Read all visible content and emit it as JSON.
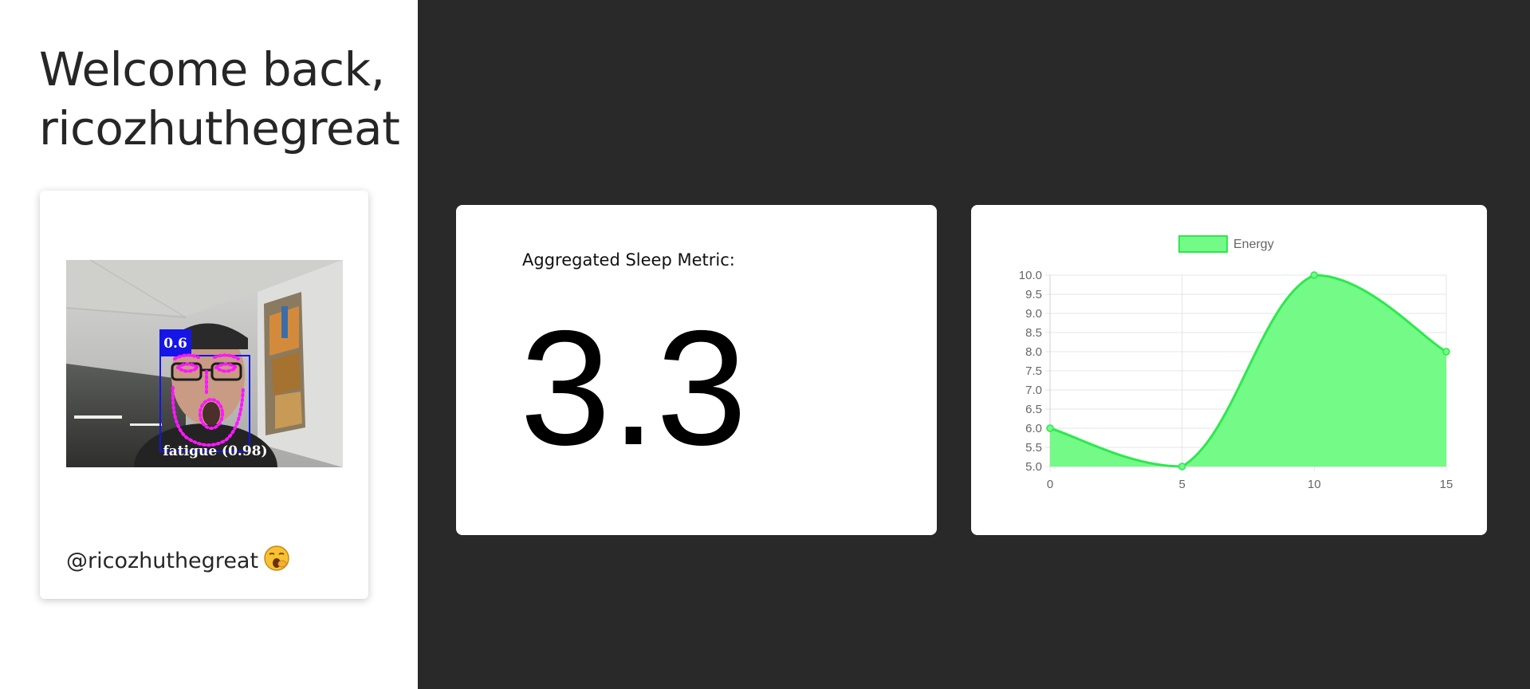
{
  "sidebar": {
    "welcome_line1": "Welcome back,",
    "welcome_line2": "ricozhuthegreat",
    "profile": {
      "detection_score": "0.6",
      "detection_label": "fatigue (0.98)",
      "handle": "@ricozhuthegreat",
      "emoji_icon": "yawning-face-icon"
    }
  },
  "metric": {
    "label": "Aggregated Sleep Metric:",
    "value": "3.3"
  },
  "chart_data": {
    "type": "area",
    "x": [
      0,
      5,
      10,
      15
    ],
    "series": [
      {
        "name": "Energy",
        "values": [
          6.0,
          5.0,
          10.0,
          8.0
        ],
        "color": "#2ee84e",
        "fill": "#74fb87"
      }
    ],
    "xticks": [
      "0",
      "5",
      "10",
      "15"
    ],
    "yticks": [
      "5.0",
      "5.5",
      "6.0",
      "6.5",
      "7.0",
      "7.5",
      "8.0",
      "8.5",
      "9.0",
      "9.5",
      "10.0"
    ],
    "xlim": [
      0,
      15
    ],
    "ylim": [
      5,
      10
    ],
    "grid": true,
    "legend": "top",
    "smooth": true
  }
}
